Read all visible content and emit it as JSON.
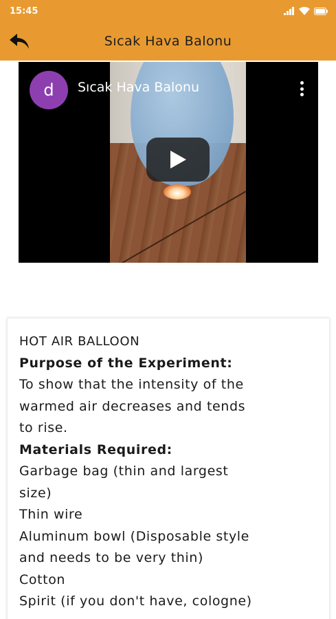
{
  "status_bar": {
    "time": "15:45",
    "icons": [
      "signal-icon",
      "wifi-icon",
      "battery-icon"
    ]
  },
  "app_bar": {
    "title": "Sıcak Hava Balonu",
    "back_icon": "back-arrow-icon"
  },
  "video": {
    "channel_initial": "d",
    "title": "Sıcak Hava Balonu",
    "play_icon": "play-icon",
    "menu_icon": "more-vert-icon"
  },
  "article": {
    "title": "HOT AIR BALLOON",
    "purpose_heading": "Purpose of the Experiment:",
    "purpose_lines": [
      "To show that the intensity of the",
      "warmed air decreases and tends",
      "to rise."
    ],
    "materials_heading": "Materials Required:",
    "materials_lines": [
      "Garbage bag (thin and largest",
      "size)",
      "Thin wire",
      "Aluminum bowl (Disposable style",
      "and needs to be very thin)",
      "Cotton",
      "Spirit (if you don't have, cologne)"
    ]
  },
  "colors": {
    "accent": "#e89a30",
    "avatar": "#8d3fb0"
  }
}
